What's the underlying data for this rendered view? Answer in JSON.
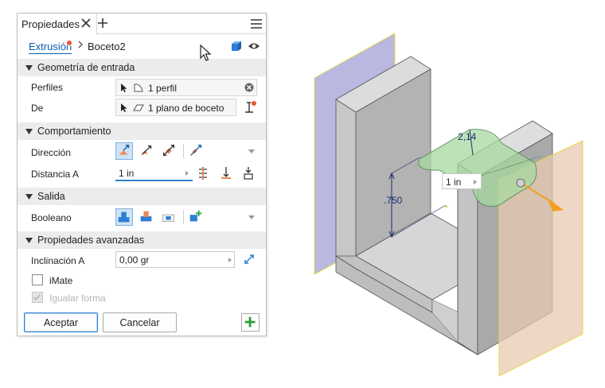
{
  "panel": {
    "tab_title": "Propiedades",
    "breadcrumb": {
      "feature": "Extrusión",
      "sketch": "Boceto2"
    }
  },
  "sections": {
    "input_geometry": {
      "title": "Geometría de entrada",
      "profiles_label": "Perfiles",
      "profiles_value": "1 perfil",
      "from_label": "De",
      "from_value": "1 plano de boceto"
    },
    "behavior": {
      "title": "Comportamiento",
      "direction_label": "Dirección",
      "distance_label": "Distancia A",
      "distance_value": "1 in"
    },
    "output": {
      "title": "Salida",
      "boolean_label": "Booleano"
    },
    "advanced": {
      "title": "Propiedades avanzadas",
      "taper_label": "Inclinación A",
      "taper_value": "0,00 gr",
      "imate_label": "iMate",
      "imate_checked": false,
      "match_shape_label": "Igualar forma",
      "match_shape_checked": true,
      "match_shape_enabled": false
    }
  },
  "buttons": {
    "ok": "Aceptar",
    "cancel": "Cancelar"
  },
  "viewport": {
    "dim_vertical": ".750",
    "dim_radius": "2,14",
    "distance_overlay": "1 in"
  },
  "colors": {
    "accent": "#2f7fd0",
    "link": "#0a5fb4",
    "section_bg": "#ececec",
    "badge": "#e8572b",
    "preview_green": "#a8d8a0",
    "plane_left": "#b8b8e0",
    "plane_right": "#e8c9b0",
    "arrow_orange": "#f0a020"
  }
}
